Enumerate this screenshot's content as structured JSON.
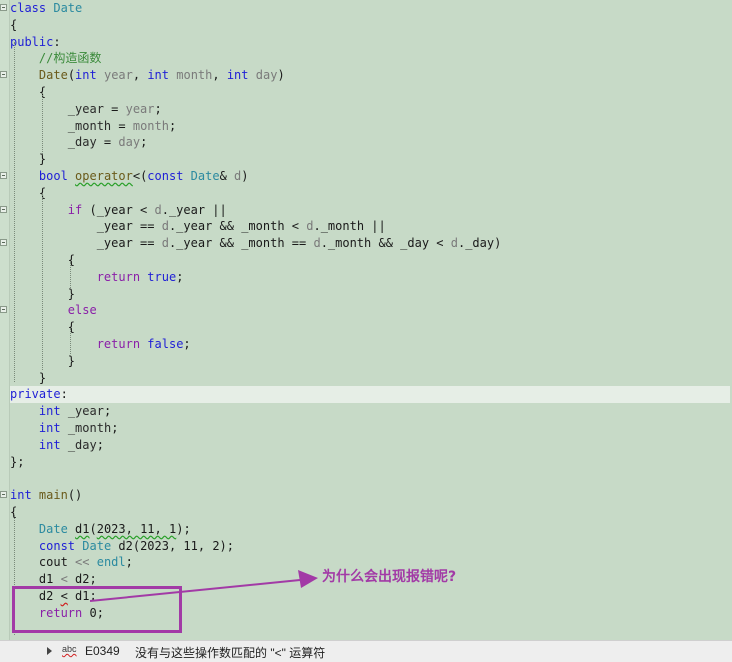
{
  "code": {
    "lines": [
      {
        "fold": true,
        "parts": [
          {
            "c": "kw",
            "t": "class"
          },
          {
            "t": " "
          },
          {
            "c": "ty",
            "t": "Date"
          }
        ]
      },
      {
        "parts": [
          {
            "t": "{"
          }
        ]
      },
      {
        "parts": [
          {
            "c": "kw",
            "t": "public"
          },
          {
            "t": ":"
          }
        ]
      },
      {
        "parts": [
          {
            "t": "    "
          },
          {
            "c": "cm",
            "t": "//构造函数"
          }
        ]
      },
      {
        "fold": true,
        "parts": [
          {
            "t": "    "
          },
          {
            "c": "fn",
            "t": "Date"
          },
          {
            "t": "("
          },
          {
            "c": "kw",
            "t": "int"
          },
          {
            "t": " "
          },
          {
            "c": "pm",
            "t": "year"
          },
          {
            "t": ", "
          },
          {
            "c": "kw",
            "t": "int"
          },
          {
            "t": " "
          },
          {
            "c": "pm",
            "t": "month"
          },
          {
            "t": ", "
          },
          {
            "c": "kw",
            "t": "int"
          },
          {
            "t": " "
          },
          {
            "c": "pm",
            "t": "day"
          },
          {
            "t": ")"
          }
        ]
      },
      {
        "parts": [
          {
            "t": "    {"
          }
        ]
      },
      {
        "parts": [
          {
            "t": "        "
          },
          {
            "c": "mb",
            "t": "_year"
          },
          {
            "t": " = "
          },
          {
            "c": "pm",
            "t": "year"
          },
          {
            "t": ";"
          }
        ]
      },
      {
        "parts": [
          {
            "t": "        "
          },
          {
            "c": "mb",
            "t": "_month"
          },
          {
            "t": " = "
          },
          {
            "c": "pm",
            "t": "month"
          },
          {
            "t": ";"
          }
        ]
      },
      {
        "parts": [
          {
            "t": "        "
          },
          {
            "c": "mb",
            "t": "_day"
          },
          {
            "t": " = "
          },
          {
            "c": "pm",
            "t": "day"
          },
          {
            "t": ";"
          }
        ]
      },
      {
        "parts": [
          {
            "t": "    }"
          }
        ]
      },
      {
        "fold": true,
        "parts": [
          {
            "t": "    "
          },
          {
            "c": "kw",
            "t": "bool"
          },
          {
            "t": " "
          },
          {
            "c": "fn squig",
            "t": "operator"
          },
          {
            "t": "<("
          },
          {
            "c": "kw",
            "t": "const"
          },
          {
            "t": " "
          },
          {
            "c": "ty",
            "t": "Date"
          },
          {
            "t": "& "
          },
          {
            "c": "pm",
            "t": "d"
          },
          {
            "t": ")"
          }
        ]
      },
      {
        "parts": [
          {
            "t": "    {"
          }
        ]
      },
      {
        "fold": true,
        "parts": [
          {
            "t": "        "
          },
          {
            "c": "ctl",
            "t": "if"
          },
          {
            "t": " (_year < "
          },
          {
            "c": "pm",
            "t": "d"
          },
          {
            "t": "._year ||"
          }
        ]
      },
      {
        "parts": [
          {
            "t": "            _year == "
          },
          {
            "c": "pm",
            "t": "d"
          },
          {
            "t": "._year && _month < "
          },
          {
            "c": "pm",
            "t": "d"
          },
          {
            "t": "._month ||"
          }
        ]
      },
      {
        "fold": true,
        "parts": [
          {
            "t": "            _year == "
          },
          {
            "c": "pm",
            "t": "d"
          },
          {
            "t": "._year && _month == "
          },
          {
            "c": "pm",
            "t": "d"
          },
          {
            "t": "._month && _day < "
          },
          {
            "c": "pm",
            "t": "d"
          },
          {
            "t": "._day)"
          }
        ]
      },
      {
        "parts": [
          {
            "t": "        {"
          }
        ]
      },
      {
        "parts": [
          {
            "t": "            "
          },
          {
            "c": "ctl",
            "t": "return"
          },
          {
            "t": " "
          },
          {
            "c": "kw",
            "t": "true"
          },
          {
            "t": ";"
          }
        ]
      },
      {
        "parts": [
          {
            "t": "        }"
          }
        ]
      },
      {
        "fold": true,
        "parts": [
          {
            "t": "        "
          },
          {
            "c": "ctl",
            "t": "else"
          }
        ]
      },
      {
        "parts": [
          {
            "t": "        {"
          }
        ]
      },
      {
        "parts": [
          {
            "t": "            "
          },
          {
            "c": "ctl",
            "t": "return"
          },
          {
            "t": " "
          },
          {
            "c": "kw",
            "t": "false"
          },
          {
            "t": ";"
          }
        ]
      },
      {
        "parts": [
          {
            "t": "        }"
          }
        ]
      },
      {
        "parts": [
          {
            "t": "    }"
          }
        ]
      },
      {
        "hl": true,
        "parts": [
          {
            "c": "kw",
            "t": "private"
          },
          {
            "t": ":"
          }
        ]
      },
      {
        "parts": [
          {
            "t": "    "
          },
          {
            "c": "kw",
            "t": "int"
          },
          {
            "t": " "
          },
          {
            "c": "mb",
            "t": "_year"
          },
          {
            "t": ";"
          }
        ]
      },
      {
        "parts": [
          {
            "t": "    "
          },
          {
            "c": "kw",
            "t": "int"
          },
          {
            "t": " "
          },
          {
            "c": "mb",
            "t": "_month"
          },
          {
            "t": ";"
          }
        ]
      },
      {
        "parts": [
          {
            "t": "    "
          },
          {
            "c": "kw",
            "t": "int"
          },
          {
            "t": " "
          },
          {
            "c": "mb",
            "t": "_day"
          },
          {
            "t": ";"
          }
        ]
      },
      {
        "parts": [
          {
            "t": "};"
          }
        ]
      },
      {
        "parts": [
          {
            "t": ""
          }
        ]
      },
      {
        "fold": true,
        "parts": [
          {
            "c": "kw",
            "t": "int"
          },
          {
            "t": " "
          },
          {
            "c": "fn",
            "t": "main"
          },
          {
            "t": "()"
          }
        ]
      },
      {
        "parts": [
          {
            "t": "{"
          }
        ]
      },
      {
        "parts": [
          {
            "t": "    "
          },
          {
            "c": "ty",
            "t": "Date"
          },
          {
            "t": " "
          },
          {
            "c": "squig",
            "t": "d1"
          },
          {
            "t": "("
          },
          {
            "c": "squig",
            "t": "2023, 11, 1"
          },
          {
            "t": ");"
          }
        ]
      },
      {
        "parts": [
          {
            "t": "    "
          },
          {
            "c": "kw",
            "t": "const"
          },
          {
            "t": " "
          },
          {
            "c": "ty",
            "t": "Date"
          },
          {
            "t": " d2(2023, 11, 2);"
          }
        ]
      },
      {
        "parts": [
          {
            "t": "    cout "
          },
          {
            "c": "pm",
            "t": "<<"
          },
          {
            "t": " "
          },
          {
            "c": "ty",
            "t": "endl"
          },
          {
            "t": ";"
          }
        ]
      },
      {
        "parts": [
          {
            "t": "    d1 "
          },
          {
            "c": "pm",
            "t": "<"
          },
          {
            "t": " d2;"
          }
        ]
      },
      {
        "parts": [
          {
            "t": "    d2 "
          },
          {
            "c": "squig-red",
            "t": "<"
          },
          {
            "t": " d1;"
          }
        ]
      },
      {
        "parts": [
          {
            "t": "    "
          },
          {
            "c": "ctl",
            "t": "return"
          },
          {
            "t": " 0;"
          }
        ]
      }
    ]
  },
  "annotation": {
    "text": "为什么会出现报错呢?",
    "color": "#a23aa6"
  },
  "error_list": {
    "spell_icon": "abc",
    "code": "E0349",
    "message": "没有与这些操作数匹配的 \"<\" 运算符"
  }
}
